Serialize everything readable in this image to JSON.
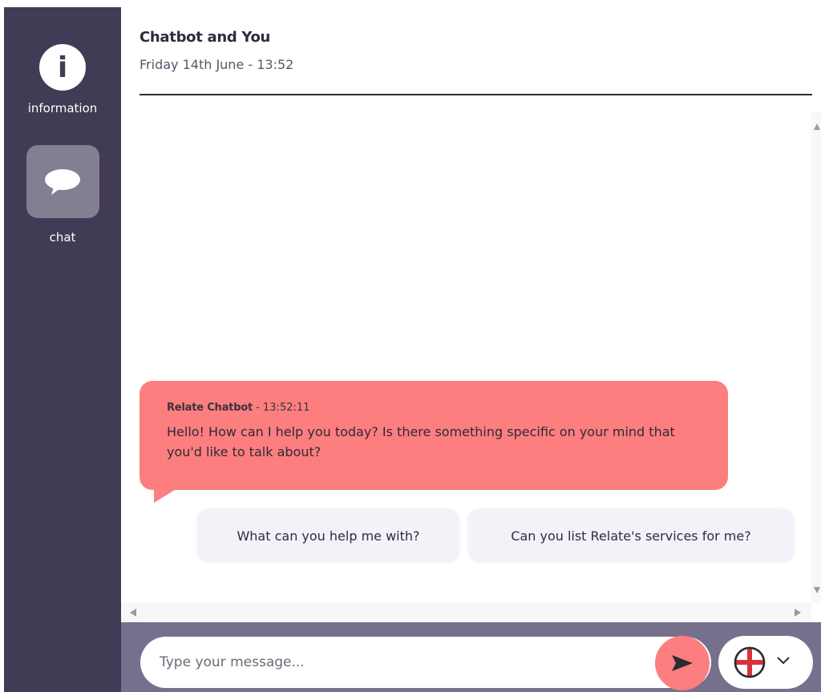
{
  "sidebar": {
    "items": [
      {
        "label": "information",
        "icon": "info-icon",
        "active": false
      },
      {
        "label": "chat",
        "icon": "chat-bubble-icon",
        "active": true
      }
    ],
    "info_glyph": "i"
  },
  "header": {
    "title": "Chatbot and You",
    "date": "Friday 14th June - 13:52"
  },
  "messages": [
    {
      "sender": "Relate Chatbot",
      "separator": " - ",
      "time": "13:52:11",
      "text": "Hello! How can I help you today? Is there something specific on your mind that you'd like to talk about?"
    }
  ],
  "suggestions": [
    {
      "label": "What can you help me with?"
    },
    {
      "label": "Can you list Relate's services for me?"
    }
  ],
  "composer": {
    "placeholder": "Type your message...",
    "send_icon": "send-arrow-icon",
    "language_icon": "england-flag-icon",
    "dropdown_icon": "chevron-down-icon"
  },
  "colors": {
    "sidebar": "#423b55",
    "accent": "#fd7e7e",
    "footer": "#77708c",
    "chip": "#f5f1f9",
    "active_tile": "#847e93"
  }
}
